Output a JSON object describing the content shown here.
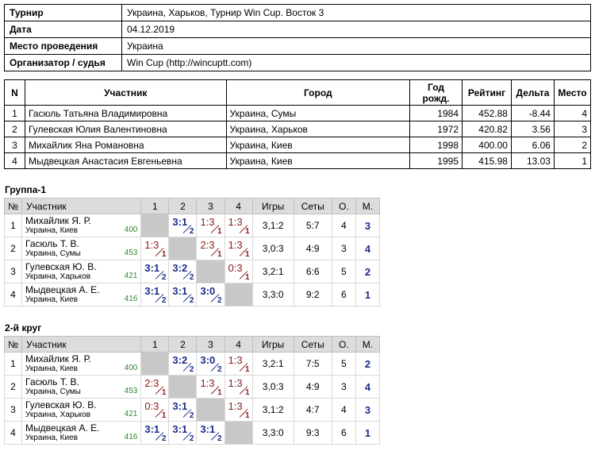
{
  "info": {
    "rows": [
      {
        "label": "Турнир",
        "value": "Украина, Харьков, Турнир Win Cup. Восток 3"
      },
      {
        "label": "Дата",
        "value": "04.12.2019"
      },
      {
        "label": "Место проведения",
        "value": "Украина"
      },
      {
        "label": "Организатор / судья",
        "value": "Win Cup (http://wincuptt.com)"
      }
    ]
  },
  "players": {
    "headers": {
      "n": "N",
      "name": "Участник",
      "city": "Город",
      "year": "Год рожд.",
      "rating": "Рейтинг",
      "delta": "Дельта",
      "place": "Место"
    },
    "rows": [
      {
        "n": "1",
        "name": "Гасюль Татьяна Владимировна",
        "city": "Украина, Сумы",
        "year": "1984",
        "rating": "452.88",
        "delta": "-8.44",
        "place": "4"
      },
      {
        "n": "2",
        "name": "Гулевская Юлия Валентиновна",
        "city": "Украина, Харьков",
        "year": "1972",
        "rating": "420.82",
        "delta": "3.56",
        "place": "3"
      },
      {
        "n": "3",
        "name": "Михайлик Яна Романовна",
        "city": "Украина, Киев",
        "year": "1998",
        "rating": "400.00",
        "delta": "6.06",
        "place": "2"
      },
      {
        "n": "4",
        "name": "Мыдвецкая Анастасия Евгеньевна",
        "city": "Украина, Киев",
        "year": "1995",
        "rating": "415.98",
        "delta": "13.03",
        "place": "1"
      }
    ]
  },
  "grid_headers": {
    "n": "№",
    "player": "Участник",
    "c1": "1",
    "c2": "2",
    "c3": "3",
    "c4": "4",
    "games": "Игры",
    "sets": "Сеты",
    "o": "О.",
    "m": "М."
  },
  "group1": {
    "title": "Группа-1",
    "rows": [
      {
        "n": "1",
        "name": "Михайлик Я. Р.",
        "city": "Украина, Киев",
        "rating": "400",
        "cells": [
          {
            "blank": true
          },
          {
            "score": "3:1",
            "res": "w",
            "pts": "2"
          },
          {
            "score": "1:3",
            "res": "l",
            "pts": "1"
          },
          {
            "score": "1:3",
            "res": "l",
            "pts": "1"
          }
        ],
        "games": "3,1:2",
        "sets": "5:7",
        "o": "4",
        "m": "3"
      },
      {
        "n": "2",
        "name": "Гасюль Т. В.",
        "city": "Украина, Сумы",
        "rating": "453",
        "cells": [
          {
            "score": "1:3",
            "res": "l",
            "pts": "1"
          },
          {
            "blank": true
          },
          {
            "score": "2:3",
            "res": "l",
            "pts": "1"
          },
          {
            "score": "1:3",
            "res": "l",
            "pts": "1"
          }
        ],
        "games": "3,0:3",
        "sets": "4:9",
        "o": "3",
        "m": "4"
      },
      {
        "n": "3",
        "name": "Гулевская Ю. В.",
        "city": "Украина, Харьков",
        "rating": "421",
        "cells": [
          {
            "score": "3:1",
            "res": "w",
            "pts": "2"
          },
          {
            "score": "3:2",
            "res": "w",
            "pts": "2"
          },
          {
            "blank": true
          },
          {
            "score": "0:3",
            "res": "l",
            "pts": "1"
          }
        ],
        "games": "3,2:1",
        "sets": "6:6",
        "o": "5",
        "m": "2"
      },
      {
        "n": "4",
        "name": "Мыдвецкая А. Е.",
        "city": "Украина, Киев",
        "rating": "416",
        "cells": [
          {
            "score": "3:1",
            "res": "w",
            "pts": "2"
          },
          {
            "score": "3:1",
            "res": "w",
            "pts": "2"
          },
          {
            "score": "3:0",
            "res": "w",
            "pts": "2"
          },
          {
            "blank": true
          }
        ],
        "games": "3,3:0",
        "sets": "9:2",
        "o": "6",
        "m": "1"
      }
    ]
  },
  "group2": {
    "title": "2-й круг",
    "rows": [
      {
        "n": "1",
        "name": "Михайлик Я. Р.",
        "city": "Украина, Киев",
        "rating": "400",
        "cells": [
          {
            "blank": true
          },
          {
            "score": "3:2",
            "res": "w",
            "pts": "2"
          },
          {
            "score": "3:0",
            "res": "w",
            "pts": "2"
          },
          {
            "score": "1:3",
            "res": "l",
            "pts": "1"
          }
        ],
        "games": "3,2:1",
        "sets": "7:5",
        "o": "5",
        "m": "2"
      },
      {
        "n": "2",
        "name": "Гасюль Т. В.",
        "city": "Украина, Сумы",
        "rating": "453",
        "cells": [
          {
            "score": "2:3",
            "res": "l",
            "pts": "1"
          },
          {
            "blank": true
          },
          {
            "score": "1:3",
            "res": "l",
            "pts": "1"
          },
          {
            "score": "1:3",
            "res": "l",
            "pts": "1"
          }
        ],
        "games": "3,0:3",
        "sets": "4:9",
        "o": "3",
        "m": "4"
      },
      {
        "n": "3",
        "name": "Гулевская Ю. В.",
        "city": "Украина, Харьков",
        "rating": "421",
        "cells": [
          {
            "score": "0:3",
            "res": "l",
            "pts": "1"
          },
          {
            "score": "3:1",
            "res": "w",
            "pts": "2"
          },
          {
            "blank": true
          },
          {
            "score": "1:3",
            "res": "l",
            "pts": "1"
          }
        ],
        "games": "3,1:2",
        "sets": "4:7",
        "o": "4",
        "m": "3"
      },
      {
        "n": "4",
        "name": "Мыдвецкая А. Е.",
        "city": "Украина, Киев",
        "rating": "416",
        "cells": [
          {
            "score": "3:1",
            "res": "w",
            "pts": "2"
          },
          {
            "score": "3:1",
            "res": "w",
            "pts": "2"
          },
          {
            "score": "3:1",
            "res": "w",
            "pts": "2"
          },
          {
            "blank": true
          }
        ],
        "games": "3,3:0",
        "sets": "9:3",
        "o": "6",
        "m": "1"
      }
    ]
  }
}
